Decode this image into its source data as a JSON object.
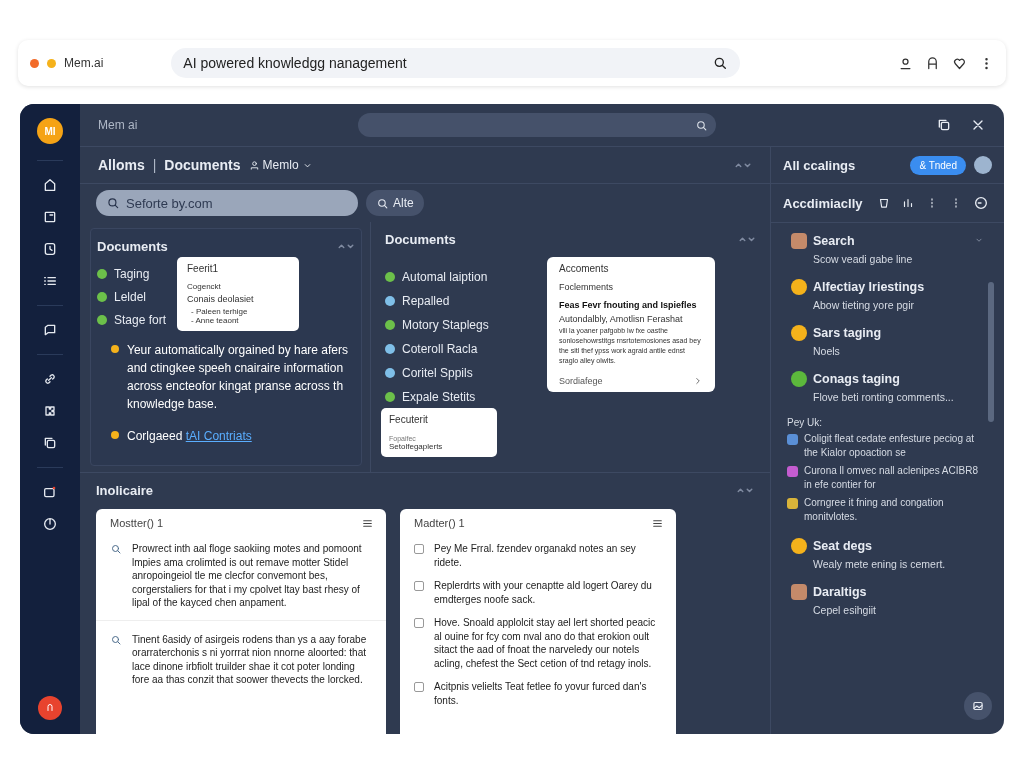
{
  "browser": {
    "site": "Mem.ai",
    "address": "AI powered knowledgg nanagement"
  },
  "app": {
    "logo": "MI",
    "title": "Mem ai"
  },
  "breadcrumb": {
    "items": [
      "Alloms",
      "Documents"
    ],
    "separator": "|",
    "workspace": "Memlo"
  },
  "search": {
    "placeholder": "Seforte by.com",
    "button": "Alte"
  },
  "left_panel": {
    "title": "Documents",
    "items": [
      {
        "label": "Taging",
        "color": "#6cc04a"
      },
      {
        "label": "Leldel",
        "color": "#6cc04a"
      },
      {
        "label": "Stage fort",
        "color": "#6cc04a"
      }
    ],
    "popup": {
      "title": "Feerit1",
      "label": "Cogenckt",
      "heading": "Conais deolasiet",
      "bullets": [
        "- Paleen terhige",
        "- Anne teaont"
      ]
    },
    "notes": [
      {
        "text": "Yeur automatically orgained by hare afers and ctingkee speeh cnairaire information across encteofor kingat pranse across th knowledge base.",
        "color": "#f5b21b"
      },
      {
        "text": "Corlgaeed",
        "link": "tAI Contriats",
        "color": "#f5b21b"
      }
    ]
  },
  "center_panel": {
    "title": "Documents",
    "items": [
      {
        "label": "Automal laiption",
        "color": "#6cc04a"
      },
      {
        "label": "Repalled",
        "color": "#7fbfe8"
      },
      {
        "label": "Motory Staplegs",
        "color": "#6cc04a"
      },
      {
        "label": "Coteroll Racla",
        "color": "#7fbfe8"
      },
      {
        "label": "Coritel Sppils",
        "color": "#7fbfe8"
      },
      {
        "label": "Expale Stetits",
        "color": "#6cc04a"
      }
    ],
    "small_card": {
      "title": "Fecuterit",
      "label": "Fopaifec",
      "value": "Setolfegaplerts"
    },
    "card": {
      "title": "Accoments",
      "subtitle": "Foclemments",
      "heading": "Feas Fevr fnouting and Ispiefles",
      "lead": "Autondalbly, Amotlisn Ferashat",
      "body": "vlli la yoaner pafgobb lw fxe oasthe sonlosehowrstitgs rnsrtotemosiones asad bey the sitl thef ypss work agraid antile ednst sraglo alley olwlts.",
      "footer": "Sordiafege"
    }
  },
  "bottom": {
    "title": "Inolicaire",
    "cards": [
      {
        "title": "Mostter() 1",
        "items": [
          {
            "kind": "query",
            "text": "Prowrect inth aal floge saokiing motes and pomoont lmpies ama crolimted is out remave motter Stidel anropoingeiol tle me clecfor convemont bes, corgerstaliers for that i my cpolvet ltay bast rhesy of lipal of the kayced chen anpament."
          },
          {
            "kind": "query",
            "text": "Tinent 6asidy of asirgeis rodens than ys a aay forabe orarraterchonis s ni yorrrat nion nnorne aloorted: that lace dinone irbfiolt truilder shae it cot poter londing fore aa thas conzit that soower thevects the lorcked."
          }
        ]
      },
      {
        "title": "Madter() 1",
        "items": [
          {
            "kind": "checkbox",
            "checked": false,
            "text": "Pey Me Frral. fzendev organakd notes an sey ridete."
          },
          {
            "kind": "checkbox",
            "checked": false,
            "text": "Replerdrts with your cenaptte ald logert Oarey du emdterges noofe sack."
          },
          {
            "kind": "checkbox",
            "checked": false,
            "text": "Hove. Snoald applolcit stay ael lert shorted peacic al ouine for fcy com nval ano do that erokion oult sitact the aad of fnoat the narveledy our notels acling, chefest the Sect cetion of tnd retagy inols."
          },
          {
            "kind": "checkbox",
            "checked": false,
            "text": "Acitpnis velielts Teat fetlee fo yovur furced dan's fonts."
          }
        ]
      }
    ]
  },
  "right_panel": {
    "title": "All ccalings",
    "button": "& Tnded",
    "toolbar_title": "Accdimiaclly",
    "items": [
      {
        "kind": "avatar",
        "title": "Search",
        "subtitle": "Scow veadi gabe line"
      },
      {
        "kind": "badge",
        "color": "#f5b21b",
        "title": "Alfectiay Iriestings",
        "subtitle": "Abow tieting yore pgir"
      },
      {
        "kind": "badge",
        "color": "#f5b21b",
        "title": "Sars taging",
        "subtitle": "Noels"
      },
      {
        "kind": "badge",
        "color": "#5cb83c",
        "title": "Conags taging",
        "subtitle": "Flove beti ronting comments..."
      }
    ],
    "timeline": {
      "title": "Pey Uk:",
      "entries": [
        {
          "color": "#5a8fd6",
          "text": "Coligit fleat cedate enfesture peciog at the Kialor opoaction se"
        },
        {
          "color": "#c45cd0",
          "text": "Curona ll omvec nall aclenipes ACIBR8 in efe contier for"
        },
        {
          "color": "#d9b43a",
          "text": "Corngree it fning and congation monitvlotes."
        }
      ]
    },
    "items_after": [
      {
        "kind": "badge",
        "color": "#f5b21b",
        "title": "Seat degs",
        "subtitle": "Wealy mete ening is cemert."
      },
      {
        "kind": "avatar",
        "title": "Daraltigs",
        "subtitle": "Cepel esihgiit"
      }
    ]
  }
}
